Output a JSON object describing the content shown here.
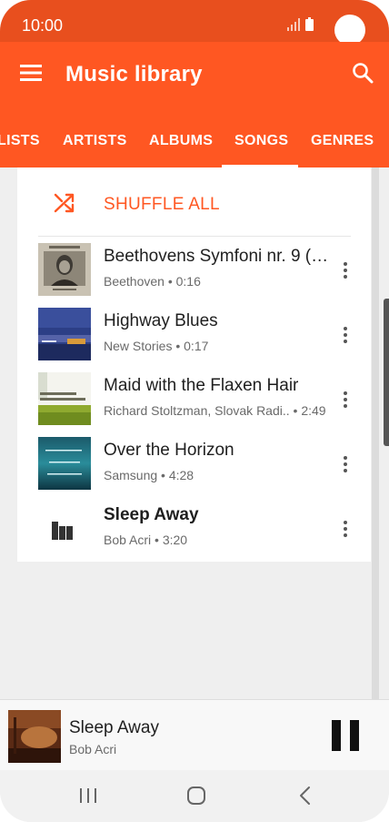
{
  "status_bar": {
    "time": "10:00",
    "icons": [
      "signal-icon",
      "battery-icon"
    ]
  },
  "app_bar": {
    "title": "Music library",
    "icons": [
      "menu-icon",
      "search-icon"
    ],
    "color": "#ff5722"
  },
  "tabs": [
    {
      "label": "LISTS",
      "selected": false
    },
    {
      "label": "ARTISTS",
      "selected": false
    },
    {
      "label": "ALBUMS",
      "selected": false
    },
    {
      "label": "SONGS",
      "selected": true
    },
    {
      "label": "GENRES",
      "selected": false
    }
  ],
  "shuffle": {
    "label": "SHUFFLE ALL",
    "icon": "shuffle-icon"
  },
  "songs": [
    {
      "title": "Beethovens Symfoni nr. 9 (S..",
      "subtitle": "Beethoven • 0:16",
      "art": "album-art-beethoven",
      "playing": false
    },
    {
      "title": "Highway Blues",
      "subtitle": "New Stories • 0:17",
      "art": "album-art-highway-blues",
      "playing": false
    },
    {
      "title": "Maid with the Flaxen Hair",
      "subtitle": "Richard Stoltzman, Slovak Radi..  • 2:49",
      "art": "album-art-richard-stoltzman",
      "playing": false
    },
    {
      "title": "Over the Horizon",
      "subtitle": "Samsung • 4:28",
      "art": "album-art-over-the-horizon",
      "playing": false
    },
    {
      "title": "Sleep Away",
      "subtitle": "Bob Acri • 3:20",
      "art": "now-playing-bars-icon",
      "playing": true
    }
  ],
  "mini_player": {
    "title": "Sleep Away",
    "artist": "Bob Acri",
    "control": "pause-icon"
  },
  "nav_bar": {
    "buttons": [
      "recent-apps-icon",
      "home-icon",
      "back-icon"
    ]
  },
  "colors": {
    "accent": "#ff5722",
    "status_bar": "#e84f1e",
    "background": "#efefef"
  }
}
